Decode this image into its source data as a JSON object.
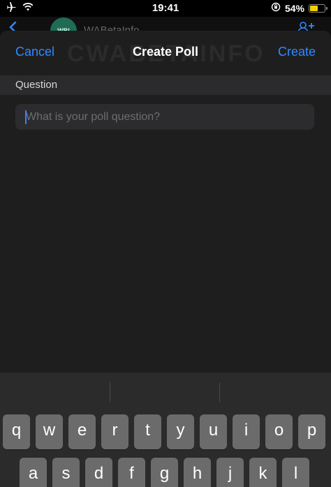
{
  "status_bar": {
    "time": "19:41",
    "battery_percent": "54%",
    "battery_level": 0.54,
    "battery_color": "#f5d000",
    "icons": [
      "airplane-icon",
      "wifi-icon",
      "orientation-lock-icon",
      "battery-icon"
    ]
  },
  "chat": {
    "avatar_text": "WBI",
    "name": "WABetaInfo"
  },
  "sheet": {
    "cancel_label": "Cancel",
    "title": "Create Poll",
    "create_label": "Create",
    "watermark": "CWABETAINFO",
    "section_label": "Question",
    "question_placeholder": "What is your poll question?",
    "question_value": ""
  },
  "keyboard": {
    "row1": [
      "q",
      "w",
      "e",
      "r",
      "t",
      "y",
      "u",
      "i",
      "o",
      "p"
    ],
    "row2": [
      "a",
      "s",
      "d",
      "f",
      "g",
      "h",
      "j",
      "k",
      "l"
    ]
  },
  "colors": {
    "accent": "#2f8bff",
    "sheet_bg": "#1e1e1f",
    "field_bg": "#2c2c2e",
    "key_bg": "#6b6b6b",
    "keyboard_bg": "#2b2b2b"
  }
}
